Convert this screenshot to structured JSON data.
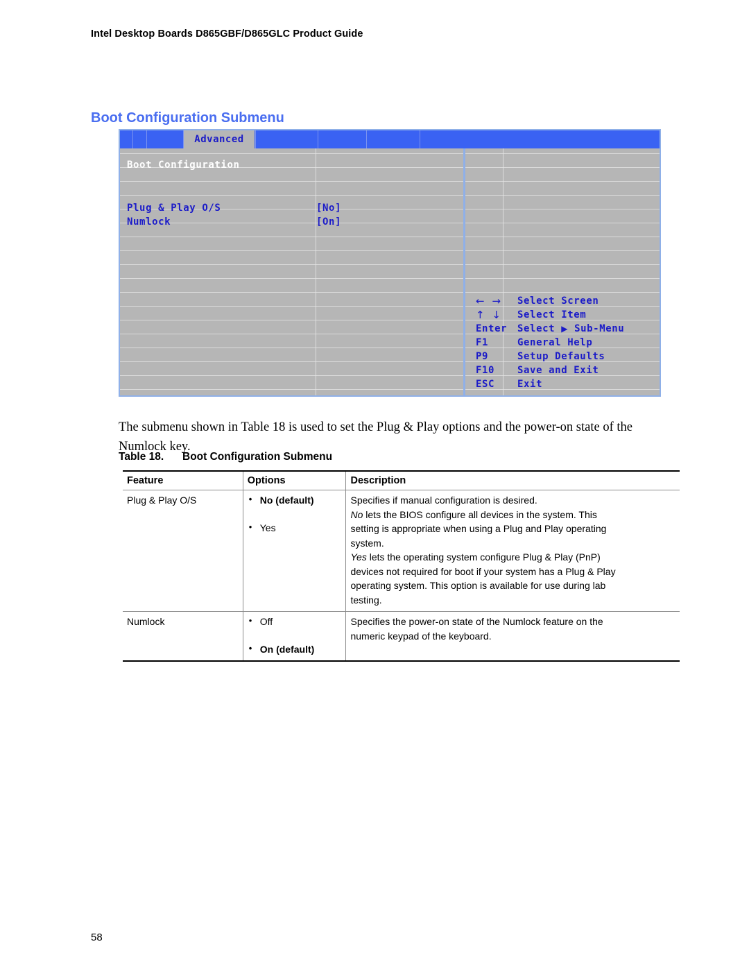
{
  "document": {
    "running_header": "Intel Desktop Boards D865GBF/D865GLC Product Guide",
    "section_heading": "Boot Configuration Submenu",
    "page_number": "58",
    "body_paragraph": "The submenu shown in Table 18 is used to set the Plug & Play options and the power-on state of the Numlock key."
  },
  "bios_screen": {
    "active_tab": "Advanced",
    "section_label": "Boot Configuration",
    "items": [
      {
        "label": "Plug & Play O/S",
        "value": "[No]"
      },
      {
        "label": "Numlock",
        "value": "[On]"
      }
    ],
    "help_legend": [
      {
        "key": "← →",
        "action": "Select Screen",
        "key_is_arrows": true
      },
      {
        "key": "↑ ↓",
        "action": "Select Item",
        "key_is_arrows": true
      },
      {
        "key": "Enter",
        "action_pre": "Select ",
        "action_tri": "▶",
        "action_post": " Sub-Menu",
        "action": "Select ▶ Sub-Menu"
      },
      {
        "key": "F1",
        "action": "General Help"
      },
      {
        "key": "P9",
        "action": "Setup Defaults"
      },
      {
        "key": "F10",
        "action": "Save and Exit"
      },
      {
        "key": "ESC",
        "action": "Exit"
      }
    ],
    "colors": {
      "menubar_blue": "#3a62f3",
      "panel_gray": "#b6b6b6",
      "text_blue": "#1b1bc8",
      "border_blue": "#8fb0e8",
      "heading_white": "#ffffff"
    }
  },
  "table": {
    "caption_number": "Table 18.",
    "caption_title": "Boot Configuration Submenu",
    "headers": [
      "Feature",
      "Options",
      "Description"
    ],
    "rows": [
      {
        "feature": "Plug & Play O/S",
        "options": [
          {
            "text": "No (default)",
            "default": true
          },
          {
            "text": "Yes",
            "default": false
          }
        ],
        "description_lines": [
          {
            "pre": "",
            "em": "",
            "post": "Specifies if manual configuration is desired."
          },
          {
            "pre": "",
            "em": "No",
            "post": " lets the BIOS configure all devices in the system.  This"
          },
          {
            "pre": "",
            "em": "",
            "post": "setting is appropriate when using a Plug and Play operating"
          },
          {
            "pre": "",
            "em": "",
            "post": "system."
          },
          {
            "pre": "",
            "em": "Yes",
            "post": " lets the operating system configure Plug & Play (PnP)"
          },
          {
            "pre": "",
            "em": "",
            "post": "devices not required for boot if your system has a Plug & Play"
          },
          {
            "pre": "",
            "em": "",
            "post": "operating system.  This option is available for use during lab"
          },
          {
            "pre": "",
            "em": "",
            "post": "testing."
          }
        ]
      },
      {
        "feature": "Numlock",
        "options": [
          {
            "text": "Off",
            "default": false
          },
          {
            "text": "On (default)",
            "default": true
          }
        ],
        "description_lines": [
          {
            "pre": "",
            "em": "",
            "post": "Specifies the power-on state of the Numlock feature on the"
          },
          {
            "pre": "",
            "em": "",
            "post": "numeric keypad of the keyboard."
          }
        ]
      }
    ]
  }
}
